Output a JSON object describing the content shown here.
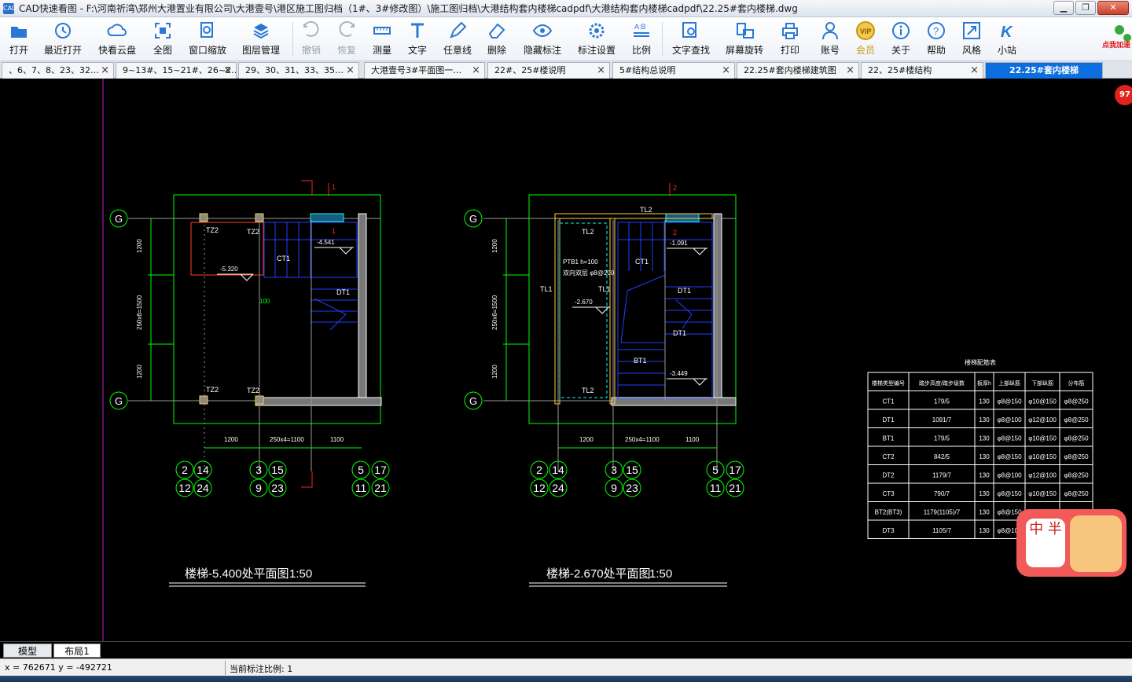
{
  "window": {
    "app_icon": "CAD",
    "title": "CAD快速看图 - F:\\河南祈湾\\郑州大港置业有限公司\\大港壹号\\港区施工图归档（1#、3#修改图）\\施工图归档\\大港结构套内楼梯cadpdf\\大港结构套内楼梯cadpdf\\22.25#套内楼梯.dwg",
    "controls": [
      "minimize",
      "maximize",
      "close"
    ]
  },
  "toolbar": {
    "items": [
      {
        "label": "打开",
        "icon": "open-folder-icon",
        "enabled": true
      },
      {
        "label": "最近打开",
        "icon": "recent-clock-icon",
        "enabled": true
      },
      {
        "label": "快看云盘",
        "icon": "cloud-icon",
        "enabled": true
      },
      {
        "label": "全图",
        "icon": "fit-all-icon",
        "enabled": true
      },
      {
        "label": "窗口缩放",
        "icon": "window-zoom-icon",
        "enabled": true
      },
      {
        "label": "图层管理",
        "icon": "layers-icon",
        "enabled": true
      },
      {
        "label": "撤销",
        "icon": "undo-icon",
        "enabled": false
      },
      {
        "label": "恢复",
        "icon": "redo-icon",
        "enabled": false
      },
      {
        "label": "测量",
        "icon": "measure-icon",
        "enabled": true
      },
      {
        "label": "文字",
        "icon": "text-icon",
        "enabled": true
      },
      {
        "label": "任意线",
        "icon": "pen-icon",
        "enabled": true
      },
      {
        "label": "删除",
        "icon": "eraser-icon",
        "enabled": true
      },
      {
        "label": "隐藏标注",
        "icon": "eye-icon",
        "enabled": true
      },
      {
        "label": "标注设置",
        "icon": "gear-icon",
        "enabled": true
      },
      {
        "label": "比例",
        "icon": "scale-ab-icon",
        "enabled": true
      },
      {
        "label": "文字查找",
        "icon": "text-search-icon",
        "enabled": true
      },
      {
        "label": "屏幕旋转",
        "icon": "rotate-screen-icon",
        "enabled": true
      },
      {
        "label": "打印",
        "icon": "printer-icon",
        "enabled": true
      },
      {
        "label": "账号",
        "icon": "user-icon",
        "enabled": true
      },
      {
        "label": "会员",
        "icon": "vip-icon",
        "enabled": true
      },
      {
        "label": "关于",
        "icon": "info-icon",
        "enabled": true
      },
      {
        "label": "帮助",
        "icon": "help-icon",
        "enabled": true
      },
      {
        "label": "风格",
        "icon": "style-expand-icon",
        "enabled": true
      },
      {
        "label": "小站",
        "icon": "k-site-icon",
        "enabled": true
      }
    ],
    "promo": "点我加速"
  },
  "tabs": [
    {
      "label": "、6、7、8、23、32…",
      "active": false
    },
    {
      "label": "9~13#、15~21#、26~2…",
      "active": false
    },
    {
      "label": "29、30、31、33、35…",
      "active": false
    },
    {
      "label": "大港壹号3#平面图一…",
      "active": false
    },
    {
      "label": "22#、25#楼说明",
      "active": false
    },
    {
      "label": "5#结构总说明",
      "active": false
    },
    {
      "label": "22.25#套内楼梯建筑图",
      "active": false
    },
    {
      "label": "22、25#楼结构",
      "active": false
    },
    {
      "label": "22.25#套内楼梯",
      "active": true
    }
  ],
  "floating_badge": "97",
  "drawing": {
    "left_plan": {
      "title": "楼梯-5.400处平面图",
      "scale": "1:50",
      "axis_rows": [
        "G",
        "G"
      ],
      "axis_bottom": [
        [
          "2",
          "14",
          "12",
          "24"
        ],
        [
          "3",
          "15",
          "9",
          "23"
        ],
        [
          "5",
          "17",
          "11",
          "21"
        ]
      ],
      "labels": [
        "TZ2",
        "TZ2",
        "TZ2",
        "TZ2",
        "CT1",
        "DT1",
        "-4.541",
        "-5.320",
        "1"
      ],
      "dims_vertical": [
        "1200",
        "250x6=1500",
        "1200"
      ],
      "dims_horizontal": [
        "1200",
        "250x4=1100",
        "1100"
      ],
      "section_mark": "1"
    },
    "right_plan": {
      "title": "楼梯-2.670处平面图",
      "scale": "1:50",
      "axis_rows": [
        "G",
        "G"
      ],
      "axis_bottom": [
        [
          "2",
          "14",
          "12",
          "24"
        ],
        [
          "3",
          "15",
          "9",
          "23"
        ],
        [
          "5",
          "17",
          "11",
          "21"
        ]
      ],
      "labels": [
        "TL2",
        "TL2",
        "TL2",
        "TL1",
        "TL1",
        "PTB1 h=100",
        "双向双层 φ8@200",
        "-2.670",
        "-1.091",
        "CT1",
        "DT1",
        "DT1",
        "BT1",
        "-3.449",
        "2"
      ],
      "dims_vertical": [
        "1200",
        "250x6=1500",
        "1200"
      ],
      "dims_horizontal": [
        "1200",
        "250x4=1100",
        "1100"
      ],
      "section_mark": "2"
    },
    "table": {
      "title": "楼梯配筋表",
      "headers": [
        "楼梯类型编号",
        "踏步高度/踏步级数",
        "板厚h",
        "上部纵筋",
        "下部纵筋",
        "分布筋"
      ],
      "rows": [
        [
          "CT1",
          "179/5",
          "130",
          "φ8@150",
          "φ10@150",
          "φ8@250"
        ],
        [
          "DT1",
          "1091/7",
          "130",
          "φ8@100",
          "φ12@100",
          "φ8@250"
        ],
        [
          "BT1",
          "179/5",
          "130",
          "φ8@150",
          "φ10@150",
          "φ8@250"
        ],
        [
          "CT2",
          "842/5",
          "130",
          "φ8@150",
          "φ10@150",
          "φ8@250"
        ],
        [
          "DT2",
          "1179/7",
          "130",
          "φ8@100",
          "φ12@100",
          "φ8@250"
        ],
        [
          "CT3",
          "790/7",
          "130",
          "φ8@150",
          "φ10@150",
          "φ8@250"
        ],
        [
          "BT2(BT3)",
          "1179(1105)/7",
          "130",
          "φ8@150",
          "φ10@150",
          "φ8@250"
        ],
        [
          "DT3",
          "1105/7",
          "130",
          "φ8@100",
          "",
          ""
        ]
      ]
    },
    "colors": {
      "green": "#00ff00",
      "white": "#ffffff",
      "blue": "#2040ff",
      "cyan": "#00ffff",
      "red": "#ff2020",
      "yellow": "#ffd040",
      "gray": "#9a9a9a",
      "magenta": "#ff00ff"
    }
  },
  "avatar": {
    "text": "中 半"
  },
  "layout_tabs": [
    {
      "label": "模型",
      "active": true
    },
    {
      "label": "布局1",
      "active": false
    }
  ],
  "status": {
    "coords": "x = 762671  y = -492721",
    "scale": "当前标注比例: 1"
  }
}
